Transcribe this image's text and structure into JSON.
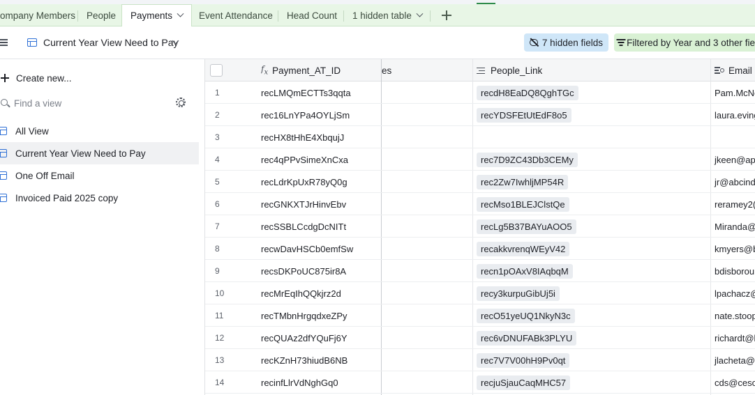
{
  "tabs": [
    {
      "label": "ompany Members"
    },
    {
      "label": "People"
    },
    {
      "label": "Payments"
    },
    {
      "label": "Event Attendance"
    },
    {
      "label": "Head Count"
    },
    {
      "label": "1 hidden table"
    }
  ],
  "toolbar": {
    "view_name": "Current Year View Need to Pay",
    "hidden_fields_label": "7 hidden fields",
    "filter_label": "Filtered by Year and 3 other fie"
  },
  "sidebar": {
    "create_label": "Create new...",
    "find_placeholder": "Find a view",
    "views": [
      {
        "label": "All View"
      },
      {
        "label": "Current Year View Need to Pay"
      },
      {
        "label": "One Off Email"
      },
      {
        "label": "Invoiced Paid 2025 copy"
      }
    ]
  },
  "grid": {
    "columns": {
      "payment_id": "Payment_AT_ID",
      "partial": "es",
      "people_link": "People_Link",
      "email": "Email ("
    },
    "rows": [
      {
        "num": "1",
        "id": "recLMQmECTTs3qqta",
        "link": "recdH8EaDQ8QghTGc",
        "email": "Pam.McNe"
      },
      {
        "num": "2",
        "id": "rec16LnYPa4OYLjSm",
        "link": "recYDSFEtUtEdF8o5",
        "email": "laura.eving"
      },
      {
        "num": "3",
        "id": "recHX8tHhE4XbqujJ",
        "link": "",
        "email": ""
      },
      {
        "num": "4",
        "id": "rec4qPPvSimeXnCxa",
        "link": "rec7D9ZC43Db3CEMy",
        "email": "jkeen@ap"
      },
      {
        "num": "5",
        "id": "recLdrKpUxR78yQ0g",
        "link": "rec2Zw7IwhljMP54R",
        "email": "jr@abcind"
      },
      {
        "num": "6",
        "id": "recGNKXTJrHinvEbv",
        "link": "recMso1BLEJClstQe",
        "email": "reramey2("
      },
      {
        "num": "7",
        "id": "recSSBLCcdgDcNITt",
        "link": "recLg5B37BAYuAOO5",
        "email": "Miranda@"
      },
      {
        "num": "8",
        "id": "recwDavHSCb0emfSw",
        "link": "recakkvrenqWEyV42",
        "email": "kmyers@b"
      },
      {
        "num": "9",
        "id": "recsDKPoUC875ir8A",
        "link": "recn1pOAxV8IAqbqM",
        "email": "bdisborou"
      },
      {
        "num": "10",
        "id": "recMrEqIhQQkjrz2d",
        "link": "recy3kurpuGibUj5i",
        "email": "lpachacz@"
      },
      {
        "num": "11",
        "id": "recTMbnHrgqdxeZPy",
        "link": "recO51yeUQ1NkyN3c",
        "email": "nate.stoop"
      },
      {
        "num": "12",
        "id": "recQUAz2dfYQuFj6Y",
        "link": "rec6vDNUFABk3PLYU",
        "email": "richardt@l"
      },
      {
        "num": "13",
        "id": "recKZnH73hiudB6NB",
        "link": "rec7V7V00hH9Pv0qt",
        "email": "jlacheta@l"
      },
      {
        "num": "14",
        "id": "recinfLlrVdNghGq0",
        "link": "recjuSjauCaqMHC57",
        "email": "cds@ceso"
      }
    ]
  }
}
